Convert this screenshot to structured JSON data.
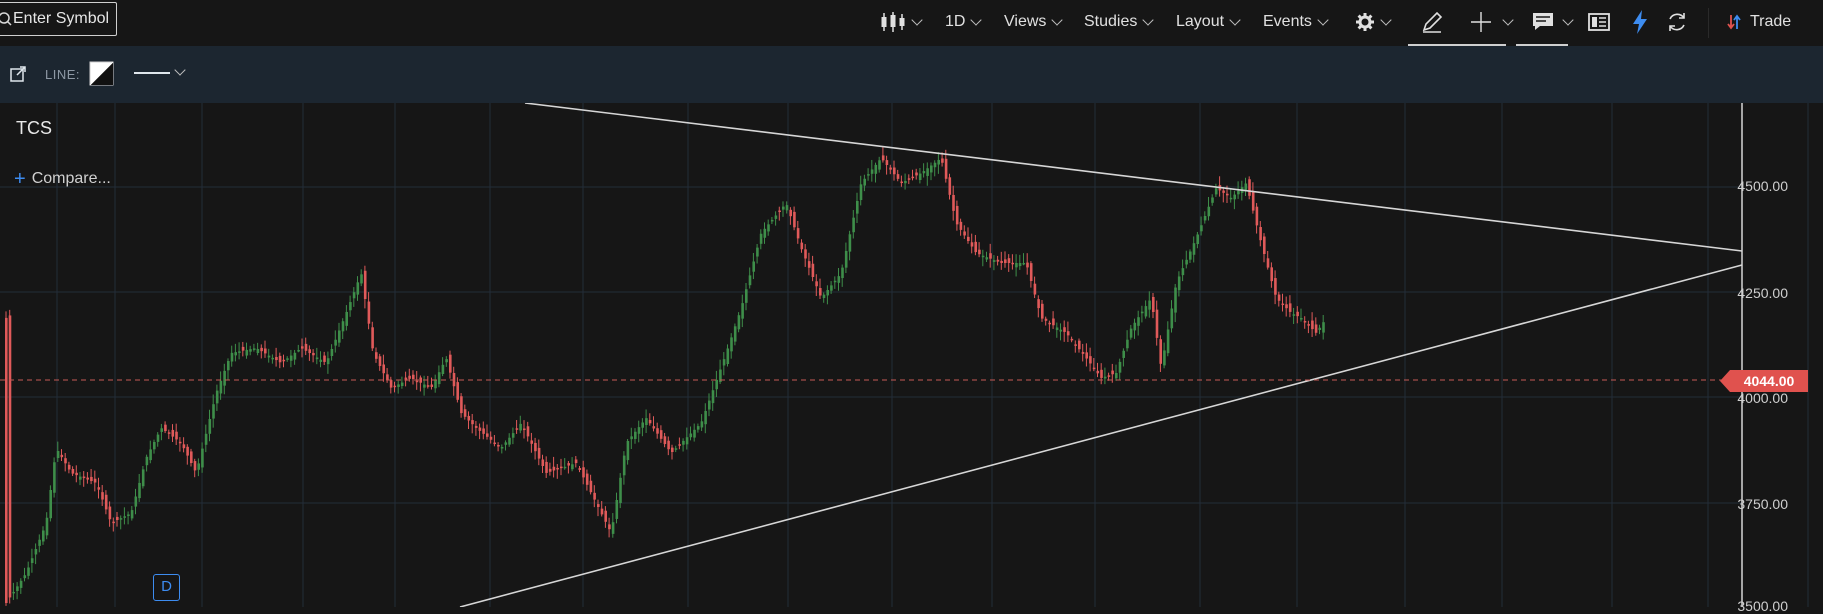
{
  "toolbar": {
    "symbol_placeholder": "Enter Symbol",
    "interval": "1D",
    "views": "Views",
    "studies": "Studies",
    "layout": "Layout",
    "events": "Events",
    "trade": "Trade"
  },
  "subbar": {
    "line_label": "LINE:"
  },
  "chart": {
    "ticker": "TCS",
    "compare": "Compare...",
    "badge": "D",
    "current_price": "4044.00",
    "price_labels": [
      "4500.00",
      "4250.00",
      "4000.00",
      "3750.00",
      "3500.00"
    ],
    "colors": {
      "up": "#3e8e4a",
      "down": "#e05a5a",
      "background": "#161616",
      "grid": "#232d38",
      "accent": "#3d8cf0"
    }
  },
  "icons": [
    "search-icon",
    "candlestick-icon",
    "gear-icon",
    "pencil-icon",
    "crosshair-icon",
    "comment-icon",
    "news-icon",
    "lightning-icon",
    "refresh-icon",
    "trade-icon",
    "popout-icon",
    "color-swatch-icon"
  ]
}
